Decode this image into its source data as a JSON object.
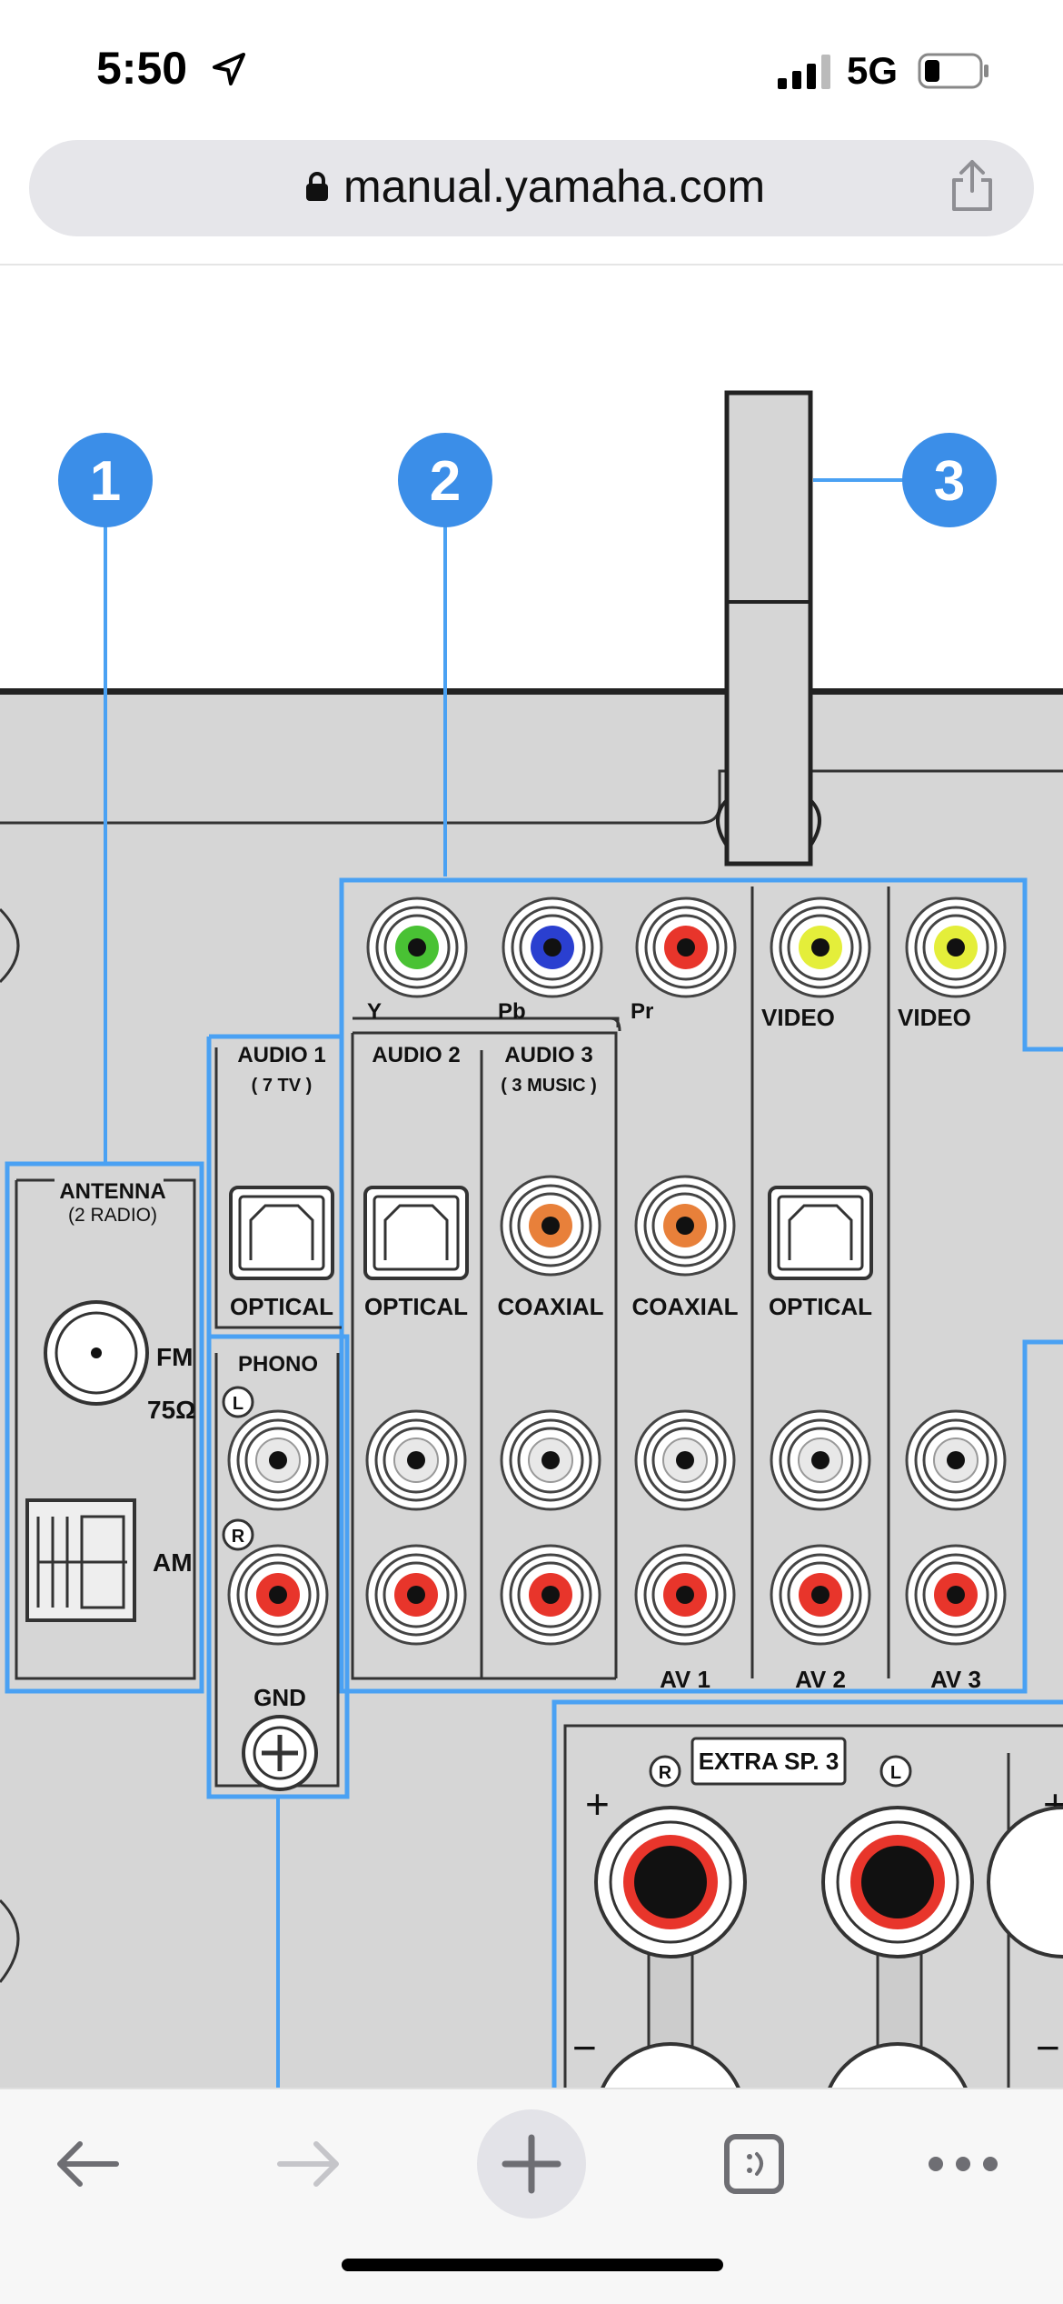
{
  "status_bar": {
    "time": "5:50",
    "network": "5G"
  },
  "browser": {
    "url": "manual.yamaha.com"
  },
  "diagram": {
    "callouts": [
      "1",
      "2",
      "3"
    ],
    "antenna": {
      "title": "ANTENNA",
      "subtitle": "(2 RADIO)",
      "fm_label": "FM",
      "fm_ohm": "75Ω",
      "am_label": "AM"
    },
    "component_labels": {
      "y": "Y",
      "pb": "Pb",
      "pr": "Pr",
      "video1": "VIDEO",
      "video2": "VIDEO"
    },
    "audio1": {
      "title": "AUDIO 1",
      "subtitle": "( 7 TV )",
      "type": "OPTICAL"
    },
    "audio2": {
      "title": "AUDIO 2",
      "type": "OPTICAL"
    },
    "audio3": {
      "title": "AUDIO 3",
      "subtitle": "( 3 MUSIC )",
      "type": "COAXIAL"
    },
    "av1": {
      "type": "COAXIAL",
      "label": "AV 1"
    },
    "av2": {
      "type": "OPTICAL",
      "label": "AV 2"
    },
    "av3": {
      "label": "AV 3"
    },
    "phono": {
      "title": "PHONO",
      "left": "L",
      "right": "R",
      "gnd": "GND"
    },
    "speaker": {
      "title": "EXTRA SP. 3",
      "right": "R",
      "left": "L",
      "plus": "+",
      "minus": "−"
    }
  },
  "colors": {
    "callout": "#3b8ee8",
    "panel": "#d5d5d5",
    "highlight": "#4aa1f3",
    "rca_red": "#e8352b",
    "rca_white": "#e8e8e8",
    "green": "#49c234",
    "blue": "#2a3fd0",
    "yellow": "#e4ee3a",
    "orange": "#e8803a"
  },
  "toolbar": {
    "back": "back-icon",
    "forward": "forward-icon",
    "new_tab": "plus-icon",
    "tabs": "tabs-icon",
    "more": "more-icon"
  }
}
